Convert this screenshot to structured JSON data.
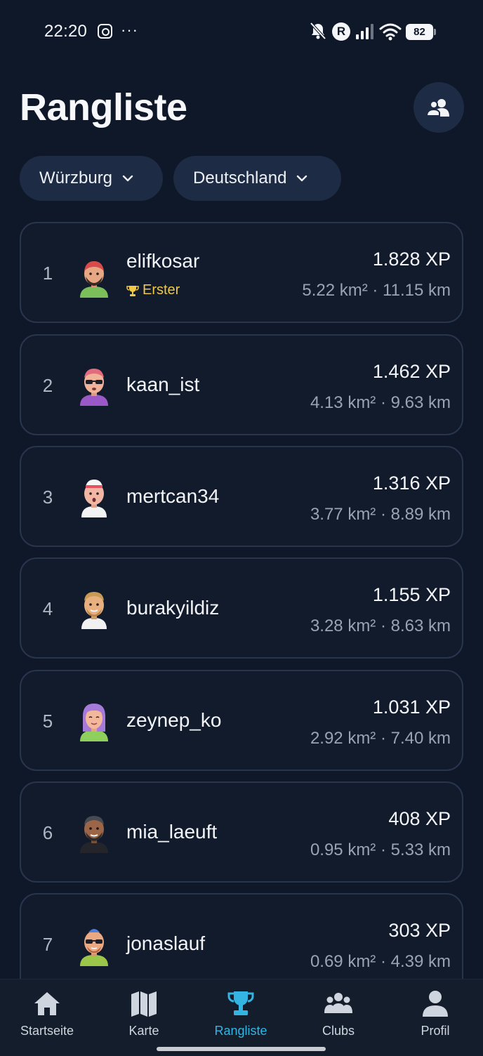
{
  "status_bar": {
    "time": "22:20",
    "more": "···",
    "r_badge": "R",
    "battery": "82"
  },
  "header": {
    "title": "Rangliste",
    "friends_icon": "users-icon"
  },
  "filters": {
    "city": "Würzburg",
    "country": "Deutschland"
  },
  "leaderboard": [
    {
      "rank": "1",
      "username": "elifkosar",
      "badge": "Erster",
      "xp": "1.828 XP",
      "stats": "5.22 km² · 11.15 km"
    },
    {
      "rank": "2",
      "username": "kaan_ist",
      "xp": "1.462 XP",
      "stats": "4.13 km² · 9.63 km"
    },
    {
      "rank": "3",
      "username": "mertcan34",
      "xp": "1.316 XP",
      "stats": "3.77 km² · 8.89 km"
    },
    {
      "rank": "4",
      "username": "burakyildiz",
      "xp": "1.155 XP",
      "stats": "3.28 km² · 8.63 km"
    },
    {
      "rank": "5",
      "username": "zeynep_ko",
      "xp": "1.031 XP",
      "stats": "2.92 km² · 7.40 km"
    },
    {
      "rank": "6",
      "username": "mia_laeuft",
      "xp": "408 XP",
      "stats": "0.95 km² · 5.33 km"
    },
    {
      "rank": "7",
      "username": "jonaslauf",
      "xp": "303 XP",
      "stats": "0.69 km² · 4.39 km"
    }
  ],
  "nav": {
    "items": [
      {
        "label": "Startseite",
        "icon": "home-icon"
      },
      {
        "label": "Karte",
        "icon": "map-icon"
      },
      {
        "label": "Rangliste",
        "icon": "trophy-icon",
        "active": true
      },
      {
        "label": "Clubs",
        "icon": "group-icon"
      },
      {
        "label": "Profil",
        "icon": "person-icon"
      }
    ]
  },
  "colors": {
    "background": "#0f1828",
    "card_border": "#27354d",
    "chip": "#1d2b44",
    "accent": "#33b4e3",
    "gold": "#f2c744"
  }
}
